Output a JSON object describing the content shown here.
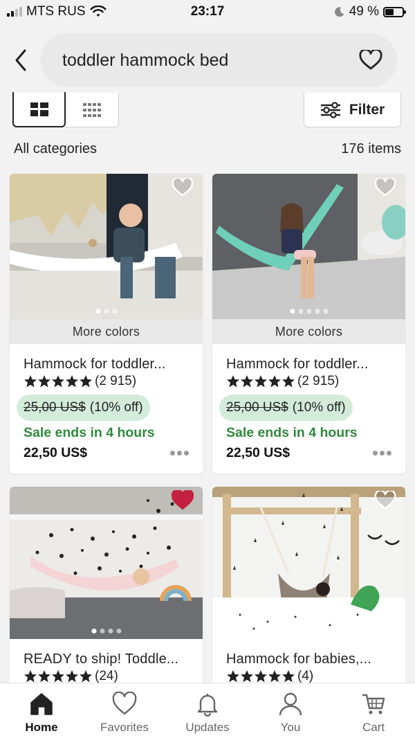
{
  "status_bar": {
    "carrier": "MTS RUS",
    "time": "23:17",
    "battery": "49 %",
    "battery_level": 0.49
  },
  "search": {
    "query": "toddler hammock bed"
  },
  "toolbar": {
    "filter_label": "Filter"
  },
  "results": {
    "category": "All categories",
    "count": "176 items"
  },
  "listings": [
    {
      "more_colors": "More colors",
      "title": "Hammock for toddler...",
      "reviews": "(2 915)",
      "original_price": "25,00 US$",
      "discount": "(10% off)",
      "sale_text": "Sale ends in 4 hours",
      "price": "22,50 US$",
      "favorited": false
    },
    {
      "more_colors": "More colors",
      "title": "Hammock for toddler...",
      "reviews": "(2 915)",
      "original_price": "25,00 US$",
      "discount": "(10% off)",
      "sale_text": "Sale ends in 4 hours",
      "price": "22,50 US$",
      "favorited": false
    },
    {
      "title": "READY to ship! Toddle...",
      "reviews": "(24)",
      "favorited": true
    },
    {
      "title": "Hammock for babies,...",
      "reviews": "(4)",
      "favorited": false
    }
  ],
  "nav": {
    "home": "Home",
    "favorites": "Favorites",
    "updates": "Updates",
    "you": "You",
    "cart": "Cart"
  },
  "colors": {
    "sale_green": "#2f8a3c",
    "pill_bg": "#d3ecd9",
    "favorite_red": "#c4203f"
  }
}
